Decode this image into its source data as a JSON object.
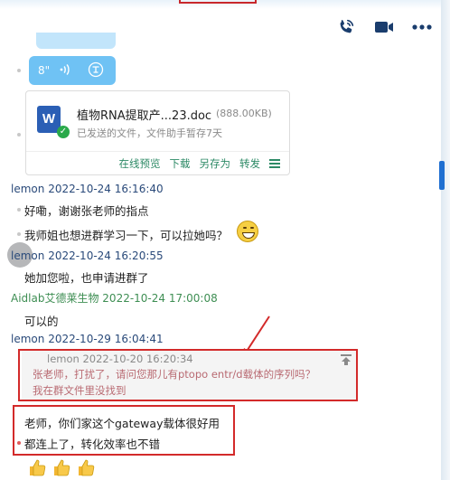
{
  "header": {
    "icons": [
      "phone-icon",
      "video-icon",
      "more-icon"
    ]
  },
  "voice_message": {
    "duration": "8\"",
    "wave_icon": "sound-wave-icon",
    "convert_icon": "voice-to-text-icon"
  },
  "file_card": {
    "file_icon": "word-doc-icon",
    "file_name": "植物RNA提取产...23.doc",
    "file_size": "(888.00KB)",
    "status": "已发送的文件，文件助手暂存7天",
    "actions": [
      "在线预览",
      "下载",
      "另存为",
      "转发"
    ],
    "menu_icon": "menu-icon"
  },
  "messages": [
    {
      "sender": "lemon",
      "time": "2022-10-24 16:16:40",
      "lines": [
        "好嘞，谢谢张老师的指点",
        "我师姐也想进群学习一下，可以拉她吗？"
      ]
    },
    {
      "sender": "lemon",
      "time": "2022-10-24 16:20:55",
      "lines": [
        "她加您啦，也申请进群了"
      ]
    },
    {
      "sender": "Aidlab艾德莱生物",
      "time": "2022-10-24 17:00:08",
      "lines": [
        "可以的"
      ]
    },
    {
      "sender": "lemon",
      "time": "2022-10-29 16:04:41",
      "quote": {
        "sender": "lemon",
        "time": "2022-10-20 16:20:34",
        "lines": [
          "张老师，打扰了，请问您那儿有ptopo entr/d载体的序列吗？",
          "我在群文件里没找到"
        ]
      },
      "lines": [
        "老师，你们家这个gateway载体很好用",
        "都连上了，转化效率也不错"
      ]
    }
  ],
  "reaction_emojis": [
    "thumbs-up-icon",
    "thumbs-up-icon",
    "thumbs-up-icon"
  ],
  "colors": {
    "voice_bubble": "#6fc2f4",
    "link_green": "#2d8a66",
    "annotation_red": "#d32a2a",
    "sender_blue": "#2a4a7a",
    "sender_green": "#3e8e53"
  }
}
